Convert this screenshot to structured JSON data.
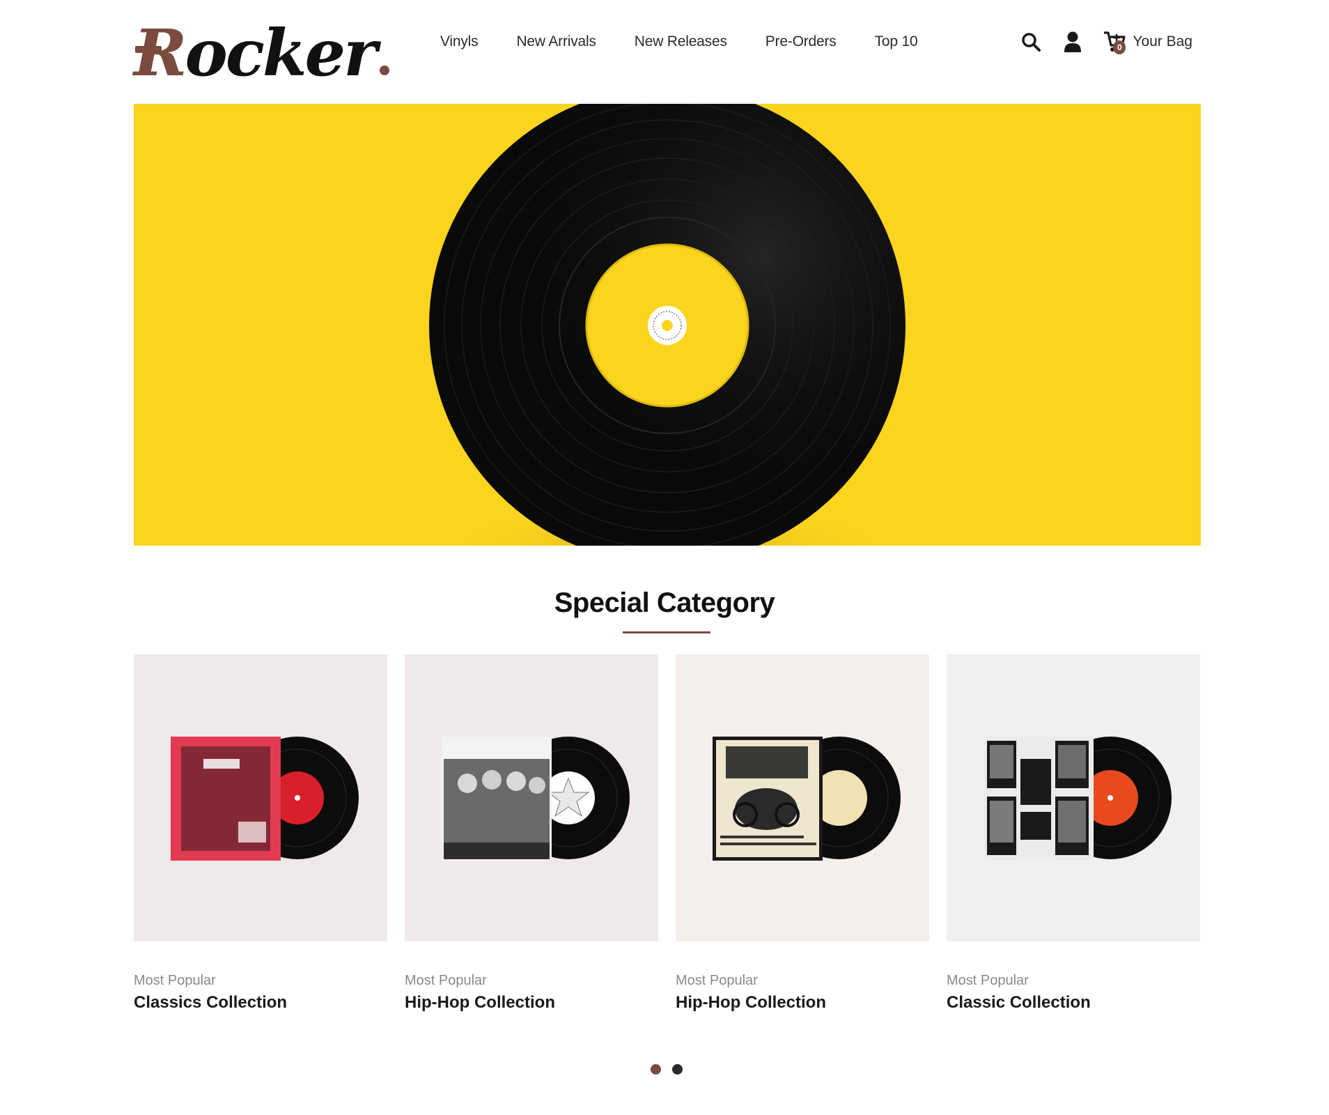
{
  "brand": {
    "logo_text_first": "R",
    "logo_text_rest": "ocker",
    "accent_color": "#7a4b3e"
  },
  "nav": {
    "items": [
      {
        "label": "Vinyls"
      },
      {
        "label": "New Arrivals"
      },
      {
        "label": "New Releases"
      },
      {
        "label": "Pre-Orders"
      },
      {
        "label": "Top 10"
      }
    ]
  },
  "header_icons": {
    "search_icon": "search-icon",
    "user_icon": "user-icon",
    "cart_icon": "cart-icon",
    "cart_count": "0",
    "bag_label": "Your Bag"
  },
  "hero": {
    "background_color": "#fbd41f",
    "image": "vinyl-record-on-yellow"
  },
  "section": {
    "title": "Special Category"
  },
  "categories": [
    {
      "subtitle": "Most Popular",
      "title": "Classics Collection",
      "sleeve_color": "#e03b52",
      "label_color": "#d8202a"
    },
    {
      "subtitle": "Most Popular",
      "title": "Hip-Hop Collection",
      "sleeve_color": "#6a6a6a",
      "label_color": "#ffffff"
    },
    {
      "subtitle": "Most Popular",
      "title": "Hip-Hop Collection",
      "sleeve_color": "#efe6cf",
      "label_color": "#f1e2b4"
    },
    {
      "subtitle": "Most Popular",
      "title": "Classic Collection",
      "sleeve_color": "#ebebeb",
      "label_color": "#e64a1e"
    }
  ],
  "carousel": {
    "pages": 2,
    "active_page": 1,
    "active_color": "#7a4b3e",
    "inactive_color": "#2a2a2a"
  }
}
